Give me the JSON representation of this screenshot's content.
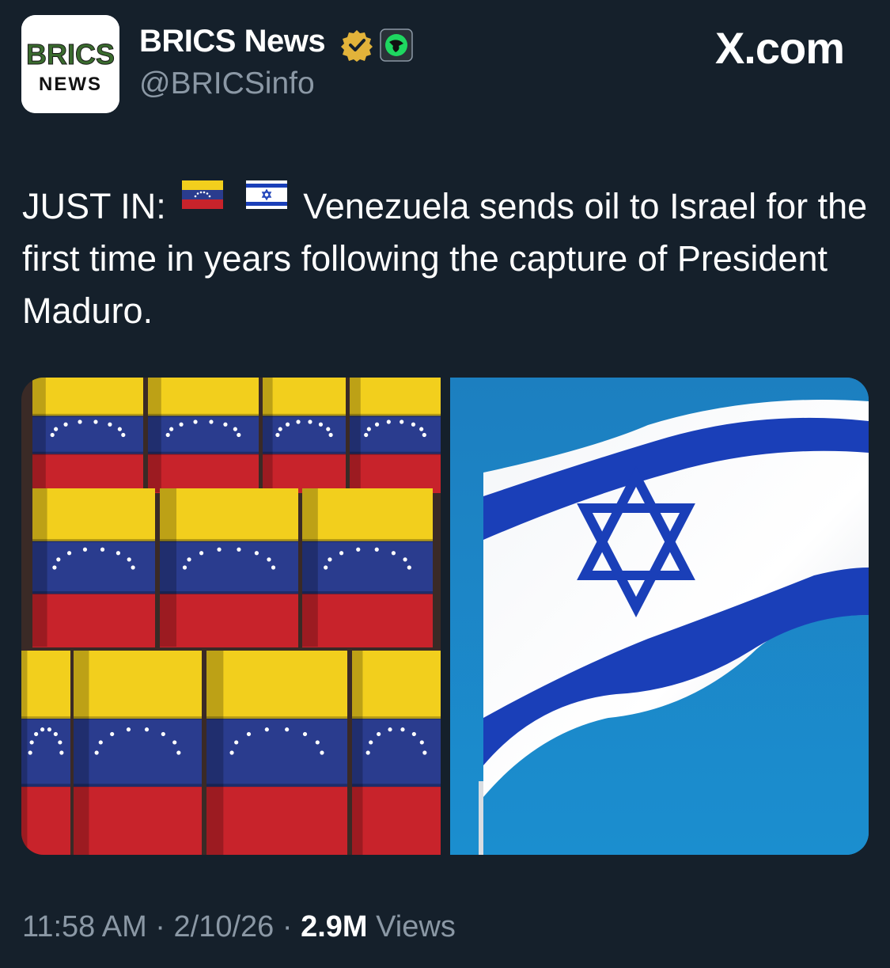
{
  "account": {
    "avatar_text_top": "BRICS",
    "avatar_text_bottom": "NEWS",
    "display_name": "BRICS News",
    "handle": "@BRICSinfo",
    "verified_icon": "verified-gold-badge-icon",
    "affiliation_icon": "affiliate-badge-icon"
  },
  "site": {
    "label": "X.com"
  },
  "tweet": {
    "prefix": "JUST IN:",
    "flag_1": "venezuela-flag-icon",
    "flag_2": "israel-flag-icon",
    "body": "Venezuela sends oil to Israel for the first time in years following the capture of President Maduro."
  },
  "media": [
    {
      "description_icon": "venezuela-flag-oil-barrels-image"
    },
    {
      "description_icon": "israel-flag-image"
    }
  ],
  "meta": {
    "time": "11:58 AM",
    "sep1": "·",
    "date": "2/10/26",
    "sep2": "·",
    "views_count": "2.9M",
    "views_label": "Views"
  },
  "colors": {
    "background": "#15202b",
    "secondary_text": "#8b98a5",
    "venezuela_yellow": "#f2cf1d",
    "venezuela_blue": "#2a3c8e",
    "venezuela_red": "#c8232b",
    "israel_blue": "#1a3fb8",
    "sky_blue": "#1b84c6"
  }
}
